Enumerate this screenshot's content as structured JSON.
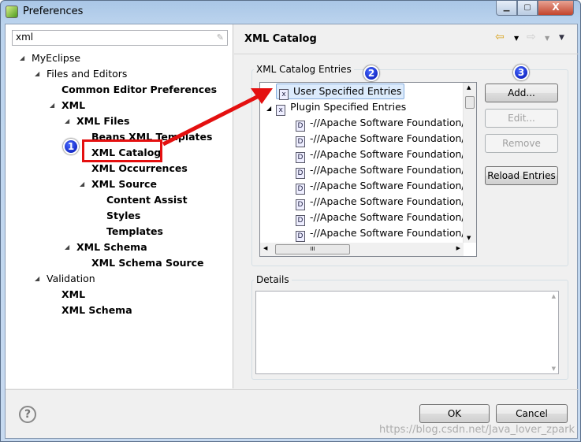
{
  "window": {
    "title": "Preferences",
    "controls": [
      "minimize",
      "maximize",
      "close"
    ]
  },
  "search": {
    "value": "xml"
  },
  "tree": [
    {
      "label": "MyEclipse",
      "level": 0,
      "bold": false,
      "expanded": true
    },
    {
      "label": "Files and Editors",
      "level": 1,
      "bold": false,
      "expanded": true
    },
    {
      "label": "Common Editor Preferences",
      "level": 2,
      "bold": true
    },
    {
      "label": "XML",
      "level": 2,
      "bold": true,
      "expanded": true
    },
    {
      "label": "XML Files",
      "level": 3,
      "bold": true,
      "expanded": true
    },
    {
      "label": "Beans XML Templates",
      "level": 4,
      "bold": true
    },
    {
      "label": "XML Catalog",
      "level": 4,
      "bold": true,
      "selected": true
    },
    {
      "label": "XML Occurrences",
      "level": 4,
      "bold": true
    },
    {
      "label": "XML Source",
      "level": 4,
      "bold": true,
      "expanded": true
    },
    {
      "label": "Content Assist",
      "level": 5,
      "bold": true
    },
    {
      "label": "Styles",
      "level": 5,
      "bold": true
    },
    {
      "label": "Templates",
      "level": 5,
      "bold": true
    },
    {
      "label": "XML Schema",
      "level": 3,
      "bold": true,
      "expanded": true
    },
    {
      "label": "XML Schema Source",
      "level": 4,
      "bold": true
    },
    {
      "label": "Validation",
      "level": 1,
      "bold": false,
      "expanded": true
    },
    {
      "label": "XML",
      "level": 2,
      "bold": true
    },
    {
      "label": "XML Schema",
      "level": 2,
      "bold": true
    }
  ],
  "page": {
    "title": "XML Catalog",
    "entries_group": "XML Catalog Entries",
    "details_group": "Details"
  },
  "entries": {
    "user": "User Specified Entries",
    "plugin": "Plugin Specified Entries",
    "items": [
      "-//Apache Software Foundation//I",
      "-//Apache Software Foundation//I",
      "-//Apache Software Foundation//I",
      "-//Apache Software Foundation//I",
      "-//Apache Software Foundation//I",
      "-//Apache Software Foundation//I",
      "-//Apache Software Foundation//I",
      "-//Apache Software Foundation//I"
    ],
    "hscroll_grip": "III"
  },
  "buttons": {
    "add": "Add...",
    "edit": "Edit...",
    "remove": "Remove",
    "reload": "Reload Entries",
    "ok": "OK",
    "cancel": "Cancel",
    "help": "?"
  },
  "annotations": {
    "one": "1",
    "two": "2",
    "three": "3",
    "color": "#e41010"
  },
  "watermark": "https://blog.csdn.net/Java_lover_zpark"
}
